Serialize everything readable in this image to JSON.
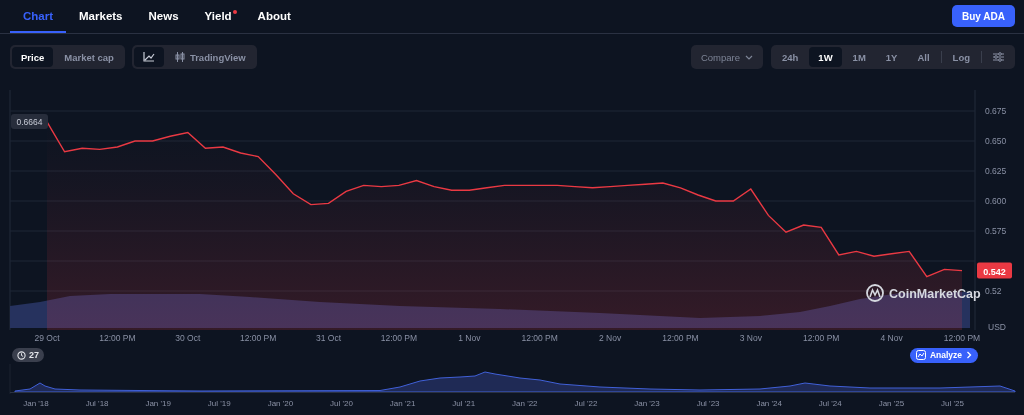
{
  "nav_tabs": [
    {
      "label": "Chart",
      "selected": true,
      "notification": false
    },
    {
      "label": "Markets",
      "selected": false,
      "notification": false
    },
    {
      "label": "News",
      "selected": false,
      "notification": false
    },
    {
      "label": "Yield",
      "selected": false,
      "notification": true
    },
    {
      "label": "About",
      "selected": false,
      "notification": false
    }
  ],
  "buy_button": "Buy ADA",
  "metric_toggle": [
    {
      "label": "Price",
      "selected": true
    },
    {
      "label": "Market cap",
      "selected": false
    }
  ],
  "view_toggle": [
    {
      "kind": "line",
      "selected": true
    },
    {
      "kind": "tradingview",
      "label": "TradingView",
      "selected": false
    }
  ],
  "compare": {
    "label": "Compare",
    "disabled": true
  },
  "ranges": [
    {
      "label": "24h",
      "selected": false
    },
    {
      "label": "1W",
      "selected": true
    },
    {
      "label": "1M",
      "selected": false
    },
    {
      "label": "1Y",
      "selected": false
    },
    {
      "label": "All",
      "selected": false
    }
  ],
  "log_toggle": {
    "label": "Log",
    "selected": false
  },
  "chart": {
    "start_label": "0.6664",
    "current_price": "0.542",
    "currency": "USD",
    "logo_text": "CoinMarketCap",
    "chart_data": {
      "type": "area",
      "grid": true,
      "ylim": [
        0.4925,
        0.6925
      ],
      "yticks": [
        0.675,
        {
          "value": 0.65,
          "label": "0.650"
        },
        0.625,
        {
          "value": 0.6,
          "label": "0.600"
        },
        0.575,
        {
          "value": 0.525,
          "label": "0.52"
        }
      ],
      "categories": [
        "29 Oct",
        null,
        null,
        null,
        "12:00 PM",
        null,
        null,
        null,
        "30 Oct",
        null,
        null,
        null,
        "12:00 PM",
        null,
        null,
        null,
        "31 Oct",
        null,
        null,
        null,
        "12:00 PM",
        null,
        null,
        null,
        "1 Nov",
        null,
        null,
        null,
        "12:00 PM",
        null,
        null,
        null,
        "2 Nov",
        null,
        null,
        null,
        "12:00 PM",
        null,
        null,
        null,
        "3 Nov",
        null,
        null,
        null,
        "12:00 PM",
        null,
        null,
        null,
        "4 Nov",
        null,
        null,
        null,
        "12:00 PM"
      ],
      "series": [
        {
          "color": "#ea3943",
          "values": [
            0.666,
            0.641,
            0.644,
            0.643,
            0.645,
            0.65,
            0.65,
            0.654,
            0.657,
            0.644,
            0.645,
            0.64,
            0.637,
            0.622,
            0.606,
            0.597,
            0.598,
            0.608,
            0.613,
            0.612,
            0.613,
            0.617,
            0.612,
            0.609,
            0.609,
            0.611,
            0.613,
            0.613,
            0.613,
            0.613,
            0.612,
            0.611,
            0.612,
            0.613,
            0.614,
            0.615,
            0.611,
            0.605,
            0.6,
            0.6,
            0.61,
            0.588,
            0.574,
            0.58,
            0.578,
            0.555,
            0.558,
            0.554,
            0.556,
            0.558,
            0.537,
            0.543,
            0.542
          ]
        }
      ]
    }
  },
  "history_badge": "27",
  "analyze_button": "Analyze",
  "navigator_labels": [
    "Jan '18",
    "Jul '18",
    "Jan '19",
    "Jul '19",
    "Jan '20",
    "Jul '20",
    "Jan '21",
    "Jul '21",
    "Jan '22",
    "Jul '22",
    "Jan '23",
    "Jul '23",
    "Jan '24",
    "Jul '24",
    "Jan '25",
    "Jul '25"
  ]
}
